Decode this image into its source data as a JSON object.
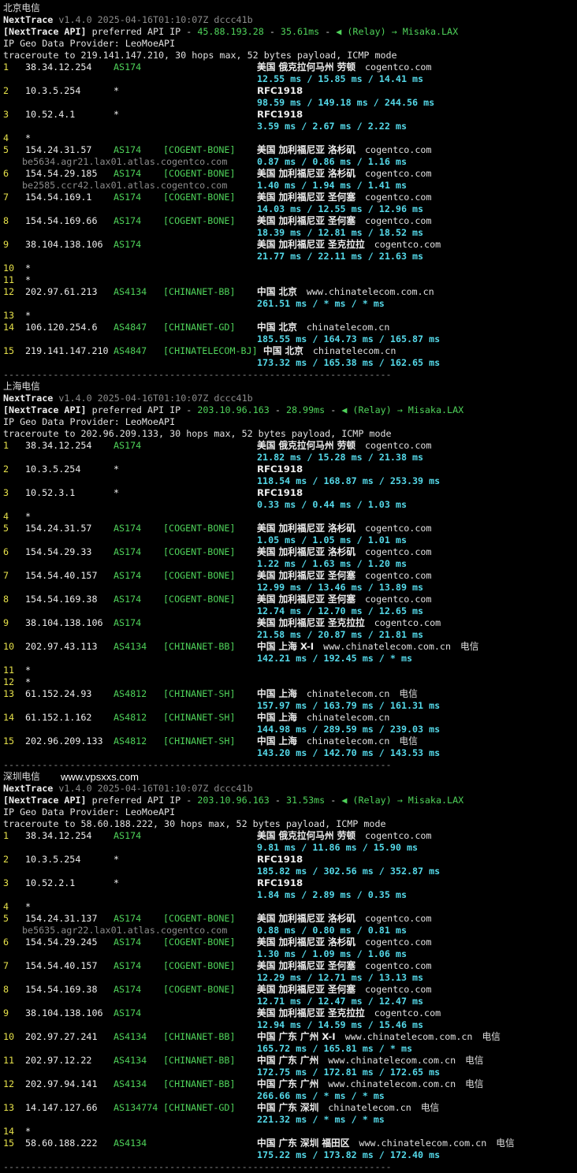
{
  "palette": {
    "background": "#000000",
    "text": "#d9d9d9",
    "version_grey": "#8c8c8c",
    "green": "#4fd35a",
    "cyan": "#54d8e8"
  },
  "sections": [
    {
      "title": "北京电信",
      "tool": "NextTrace",
      "version": "v1.4.0 2025-04-16T01:10:07Z dccc41b",
      "api_tag": "[NextTrace API]",
      "api_pref": "preferred API IP",
      "api_ip": "45.88.193.28",
      "api_latency": "35.61ms",
      "api_relay": "(Relay) → Misaka.LAX",
      "geo_provider": "IP Geo Data Provider: LeoMoeAPI",
      "traceroute": "traceroute to 219.141.147.210, 30 hops max, 52 bytes payload, ICMP mode",
      "hops": [
        {
          "num": "1",
          "ip": "38.34.12.254",
          "asn": "AS174",
          "tag": "",
          "geo": "美国 俄克拉何马州 劳顿",
          "host": "cogentco.com",
          "isp": "",
          "ptr": "",
          "rtt": "12.55 ms / 15.85 ms / 14.41 ms"
        },
        {
          "num": "2",
          "ip": "10.3.5.254",
          "asn": "*",
          "tag": "",
          "geo": "RFC1918",
          "host": "",
          "isp": "",
          "ptr": "",
          "rtt": "98.59 ms / 149.18 ms / 244.56 ms"
        },
        {
          "num": "3",
          "ip": "10.52.4.1",
          "asn": "*",
          "tag": "",
          "geo": "RFC1918",
          "host": "",
          "isp": "",
          "ptr": "",
          "rtt": "3.59 ms / 2.67 ms / 2.22 ms"
        },
        {
          "num": "4",
          "star": true
        },
        {
          "num": "5",
          "ip": "154.24.31.57",
          "asn": "AS174",
          "tag": "[COGENT-BONE]",
          "geo": "美国 加利福尼亚 洛杉矶",
          "host": "cogentco.com",
          "isp": "",
          "ptr": "be5634.agr21.lax01.atlas.cogentco.com",
          "rtt": "0.87 ms / 0.86 ms / 1.16 ms"
        },
        {
          "num": "6",
          "ip": "154.54.29.185",
          "asn": "AS174",
          "tag": "[COGENT-BONE]",
          "geo": "美国 加利福尼亚 洛杉矶",
          "host": "cogentco.com",
          "isp": "",
          "ptr": "be2585.ccr42.lax01.atlas.cogentco.com",
          "rtt": "1.40 ms / 1.94 ms / 1.41 ms"
        },
        {
          "num": "7",
          "ip": "154.54.169.1",
          "asn": "AS174",
          "tag": "[COGENT-BONE]",
          "geo": "美国 加利福尼亚 圣何塞",
          "host": "cogentco.com",
          "isp": "",
          "ptr": "",
          "rtt": "14.03 ms / 12.55 ms / 12.96 ms"
        },
        {
          "num": "8",
          "ip": "154.54.169.66",
          "asn": "AS174",
          "tag": "[COGENT-BONE]",
          "geo": "美国 加利福尼亚 圣何塞",
          "host": "cogentco.com",
          "isp": "",
          "ptr": "",
          "rtt": "18.39 ms / 12.81 ms / 18.52 ms"
        },
        {
          "num": "9",
          "ip": "38.104.138.106",
          "asn": "AS174",
          "tag": "",
          "geo": "美国 加利福尼亚 圣克拉拉",
          "host": "cogentco.com",
          "isp": "",
          "ptr": "",
          "rtt": "21.77 ms / 22.11 ms / 21.63 ms"
        },
        {
          "num": "10",
          "star": true
        },
        {
          "num": "11",
          "star": true
        },
        {
          "num": "12",
          "ip": "202.97.61.213",
          "asn": "AS4134",
          "tag": "[CHINANET-BB]",
          "geo": "中国 北京",
          "host": "www.chinatelecom.com.cn",
          "isp": "",
          "ptr": "",
          "rtt": "261.51 ms / * ms / * ms"
        },
        {
          "num": "13",
          "star": true
        },
        {
          "num": "14",
          "ip": "106.120.254.6",
          "asn": "AS4847",
          "tag": "[CHINANET-GD]",
          "geo": "中国 北京",
          "host": "chinatelecom.cn",
          "isp": "",
          "ptr": "",
          "rtt": "185.55 ms / 164.73 ms / 165.87 ms"
        },
        {
          "num": "15",
          "ip": "219.141.147.210",
          "asn": "AS4847",
          "tag": "[CHINATELECOM-BJ]",
          "geo": "中国 北京",
          "host": "chinatelecom.cn",
          "isp": "",
          "ptr": "",
          "rtt": "173.32 ms / 165.38 ms / 162.65 ms",
          "geo_shift": true
        }
      ],
      "separator": "----------------------------------------------------------------------"
    },
    {
      "title": "上海电信",
      "tool": "NextTrace",
      "version": "v1.4.0 2025-04-16T01:10:07Z dccc41b",
      "api_tag": "[NextTrace API]",
      "api_pref": "preferred API IP",
      "api_ip": "203.10.96.163",
      "api_latency": "28.99ms",
      "api_relay": "(Relay) → Misaka.LAX",
      "geo_provider": "IP Geo Data Provider: LeoMoeAPI",
      "traceroute": "traceroute to 202.96.209.133, 30 hops max, 52 bytes payload, ICMP mode",
      "hops": [
        {
          "num": "1",
          "ip": "38.34.12.254",
          "asn": "AS174",
          "tag": "",
          "geo": "美国 俄克拉何马州 劳顿",
          "host": "cogentco.com",
          "isp": "",
          "ptr": "",
          "rtt": "21.82 ms / 15.28 ms / 21.38 ms"
        },
        {
          "num": "2",
          "ip": "10.3.5.254",
          "asn": "*",
          "tag": "",
          "geo": "RFC1918",
          "host": "",
          "isp": "",
          "ptr": "",
          "rtt": "118.54 ms / 168.87 ms / 253.39 ms"
        },
        {
          "num": "3",
          "ip": "10.52.3.1",
          "asn": "*",
          "tag": "",
          "geo": "RFC1918",
          "host": "",
          "isp": "",
          "ptr": "",
          "rtt": "0.33 ms / 0.44 ms / 1.03 ms"
        },
        {
          "num": "4",
          "star": true
        },
        {
          "num": "5",
          "ip": "154.24.31.57",
          "asn": "AS174",
          "tag": "[COGENT-BONE]",
          "geo": "美国 加利福尼亚 洛杉矶",
          "host": "cogentco.com",
          "isp": "",
          "ptr": "",
          "rtt": "1.05 ms / 1.05 ms / 1.01 ms"
        },
        {
          "num": "6",
          "ip": "154.54.29.33",
          "asn": "AS174",
          "tag": "[COGENT-BONE]",
          "geo": "美国 加利福尼亚 洛杉矶",
          "host": "cogentco.com",
          "isp": "",
          "ptr": "",
          "rtt": "1.22 ms / 1.63 ms / 1.20 ms"
        },
        {
          "num": "7",
          "ip": "154.54.40.157",
          "asn": "AS174",
          "tag": "[COGENT-BONE]",
          "geo": "美国 加利福尼亚 圣何塞",
          "host": "cogentco.com",
          "isp": "",
          "ptr": "",
          "rtt": "12.99 ms / 13.46 ms / 13.89 ms"
        },
        {
          "num": "8",
          "ip": "154.54.169.38",
          "asn": "AS174",
          "tag": "[COGENT-BONE]",
          "geo": "美国 加利福尼亚 圣何塞",
          "host": "cogentco.com",
          "isp": "",
          "ptr": "",
          "rtt": "12.74 ms / 12.70 ms / 12.65 ms"
        },
        {
          "num": "9",
          "ip": "38.104.138.106",
          "asn": "AS174",
          "tag": "",
          "geo": "美国 加利福尼亚 圣克拉拉",
          "host": "cogentco.com",
          "isp": "",
          "ptr": "",
          "rtt": "21.58 ms / 20.87 ms / 21.81 ms"
        },
        {
          "num": "10",
          "ip": "202.97.43.113",
          "asn": "AS4134",
          "tag": "[CHINANET-BB]",
          "geo": "中国 上海 X-I",
          "host": "www.chinatelecom.com.cn",
          "isp": "电信",
          "ptr": "",
          "rtt": "142.21 ms / 192.45 ms / * ms"
        },
        {
          "num": "11",
          "star": true
        },
        {
          "num": "12",
          "star": true
        },
        {
          "num": "13",
          "ip": "61.152.24.93",
          "asn": "AS4812",
          "tag": "[CHINANET-SH]",
          "geo": "中国 上海",
          "host": "chinatelecom.cn",
          "isp": "电信",
          "ptr": "",
          "rtt": "157.97 ms / 163.79 ms / 161.31 ms"
        },
        {
          "num": "14",
          "ip": "61.152.1.162",
          "asn": "AS4812",
          "tag": "[CHINANET-SH]",
          "geo": "中国 上海",
          "host": "chinatelecom.cn",
          "isp": "",
          "ptr": "",
          "rtt": "144.98 ms / 289.59 ms / 239.03 ms"
        },
        {
          "num": "15",
          "ip": "202.96.209.133",
          "asn": "AS4812",
          "tag": "[CHINANET-SH]",
          "geo": "中国 上海",
          "host": "chinatelecom.cn",
          "isp": "电信",
          "ptr": "",
          "rtt": "143.20 ms / 142.70 ms / 143.53 ms"
        }
      ],
      "separator": "----------------------------------------------------------------------"
    },
    {
      "title": "深圳电信",
      "watermark": "www.vpsxxs.com",
      "tool": "NextTrace",
      "version": "v1.4.0 2025-04-16T01:10:07Z dccc41b",
      "api_tag": "[NextTrace API]",
      "api_pref": "preferred API IP",
      "api_ip": "203.10.96.163",
      "api_latency": "31.53ms",
      "api_relay": "(Relay) → Misaka.LAX",
      "geo_provider": "IP Geo Data Provider: LeoMoeAPI",
      "traceroute": "traceroute to 58.60.188.222, 30 hops max, 52 bytes payload, ICMP mode",
      "hops": [
        {
          "num": "1",
          "ip": "38.34.12.254",
          "asn": "AS174",
          "tag": "",
          "geo": "美国 俄克拉何马州 劳顿",
          "host": "cogentco.com",
          "isp": "",
          "ptr": "",
          "rtt": "9.81 ms / 11.86 ms / 15.90 ms"
        },
        {
          "num": "2",
          "ip": "10.3.5.254",
          "asn": "*",
          "tag": "",
          "geo": "RFC1918",
          "host": "",
          "isp": "",
          "ptr": "",
          "rtt": "185.82 ms / 302.56 ms / 352.87 ms"
        },
        {
          "num": "3",
          "ip": "10.52.2.1",
          "asn": "*",
          "tag": "",
          "geo": "RFC1918",
          "host": "",
          "isp": "",
          "ptr": "",
          "rtt": "1.84 ms / 2.89 ms / 0.35 ms"
        },
        {
          "num": "4",
          "star": true
        },
        {
          "num": "5",
          "ip": "154.24.31.137",
          "asn": "AS174",
          "tag": "[COGENT-BONE]",
          "geo": "美国 加利福尼亚 洛杉矶",
          "host": "cogentco.com",
          "isp": "",
          "ptr": "be5635.agr22.lax01.atlas.cogentco.com",
          "rtt": "0.88 ms / 0.80 ms / 0.81 ms"
        },
        {
          "num": "6",
          "ip": "154.54.29.245",
          "asn": "AS174",
          "tag": "[COGENT-BONE]",
          "geo": "美国 加利福尼亚 洛杉矶",
          "host": "cogentco.com",
          "isp": "",
          "ptr": "",
          "rtt": "1.30 ms / 1.09 ms / 1.06 ms"
        },
        {
          "num": "7",
          "ip": "154.54.40.157",
          "asn": "AS174",
          "tag": "[COGENT-BONE]",
          "geo": "美国 加利福尼亚 圣何塞",
          "host": "cogentco.com",
          "isp": "",
          "ptr": "",
          "rtt": "12.29 ms / 12.71 ms / 13.13 ms"
        },
        {
          "num": "8",
          "ip": "154.54.169.38",
          "asn": "AS174",
          "tag": "[COGENT-BONE]",
          "geo": "美国 加利福尼亚 圣何塞",
          "host": "cogentco.com",
          "isp": "",
          "ptr": "",
          "rtt": "12.71 ms / 12.47 ms / 12.47 ms"
        },
        {
          "num": "9",
          "ip": "38.104.138.106",
          "asn": "AS174",
          "tag": "",
          "geo": "美国 加利福尼亚 圣克拉拉",
          "host": "cogentco.com",
          "isp": "",
          "ptr": "",
          "rtt": "12.94 ms / 14.59 ms / 15.46 ms"
        },
        {
          "num": "10",
          "ip": "202.97.27.241",
          "asn": "AS4134",
          "tag": "[CHINANET-BB]",
          "geo": "中国 广东 广州 X-I",
          "host": "www.chinatelecom.com.cn",
          "isp": "电信",
          "ptr": "",
          "rtt": "165.72 ms / 165.81 ms / * ms"
        },
        {
          "num": "11",
          "ip": "202.97.12.22",
          "asn": "AS4134",
          "tag": "[CHINANET-BB]",
          "geo": "中国 广东 广州",
          "host": "www.chinatelecom.com.cn",
          "isp": "电信",
          "ptr": "",
          "rtt": "172.75 ms / 172.81 ms / 172.65 ms"
        },
        {
          "num": "12",
          "ip": "202.97.94.141",
          "asn": "AS4134",
          "tag": "[CHINANET-BB]",
          "geo": "中国 广东 广州",
          "host": "www.chinatelecom.com.cn",
          "isp": "电信",
          "ptr": "",
          "rtt": "266.66 ms / * ms / * ms"
        },
        {
          "num": "13",
          "ip": "14.147.127.66",
          "asn": "AS134774",
          "tag": "[CHINANET-GD]",
          "geo": "中国 广东 深圳",
          "host": "chinatelecom.cn",
          "isp": "电信",
          "ptr": "",
          "rtt": "221.32 ms / * ms / * ms"
        },
        {
          "num": "14",
          "star": true
        },
        {
          "num": "15",
          "ip": "58.60.188.222",
          "asn": "AS4134",
          "tag": "",
          "geo": "中国 广东 深圳 福田区",
          "host": "www.chinatelecom.com.cn",
          "isp": "电信",
          "ptr": "",
          "rtt": "175.22 ms / 173.82 ms / 172.40 ms"
        }
      ],
      "separator": "----------------------------------------------------------------------"
    }
  ]
}
